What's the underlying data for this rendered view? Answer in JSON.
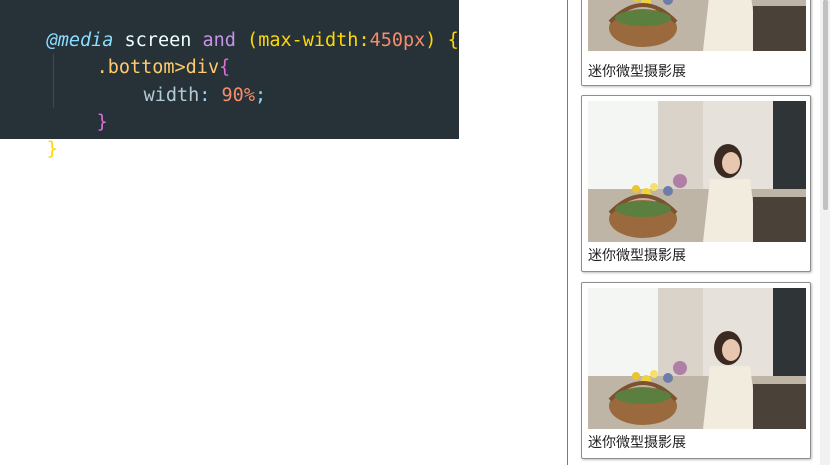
{
  "code": {
    "line1": {
      "at_rule": "@media",
      "media_type": " screen ",
      "keyword": "and",
      "open_paren": " (",
      "feature": "max-width",
      "colon": ":",
      "value": "450px",
      "close_paren": ")",
      "open_brace": " {"
    },
    "line2": {
      "selector": ".bottom>div",
      "open_brace": "{"
    },
    "line3": {
      "property": "width",
      "colon": ": ",
      "value": "90%",
      "semicolon": ";"
    },
    "line4": {
      "close_brace": "}"
    },
    "line5": {
      "close_brace": "}"
    }
  },
  "preview": {
    "cards": [
      {
        "caption": "迷你微型摄影展",
        "image": "photo-woman-with-flower-basket"
      },
      {
        "caption": "迷你微型摄影展",
        "image": "photo-woman-with-flower-basket"
      },
      {
        "caption": "迷你微型摄影展",
        "image": "photo-woman-with-flower-basket"
      }
    ]
  },
  "colors": {
    "editor_background": "#263238",
    "card_border": "#8d8d8d"
  }
}
